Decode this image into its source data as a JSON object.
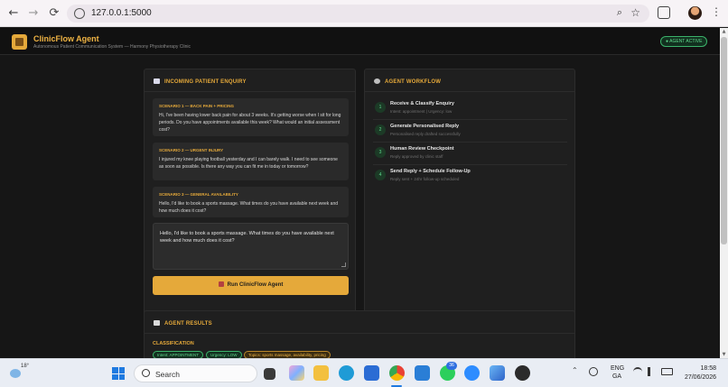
{
  "browser": {
    "url": "127.0.0.1:5000",
    "back": "←",
    "forward": "→",
    "reload": "⟳",
    "zoom_icon": "zoom-icon",
    "star": "☆",
    "kebab": "⋮"
  },
  "app": {
    "title": "ClinicFlow Agent",
    "subtitle": "Autonomous Patient Communication System — Harmony Physiotherapy Clinic",
    "status": "● AGENT ACTIVE"
  },
  "enquiry": {
    "heading": "INCOMING PATIENT ENQUIRY",
    "scenarios": [
      {
        "title": "SCENARIO 1 — BACK PAIN + PRICING",
        "text": "Hi, I've been having lower back pain for about 3 weeks. It's getting worse when I sit for long periods. Do you have appointments available this week? What would an initial assessment cost?"
      },
      {
        "title": "SCENARIO 2 — URGENT INJURY",
        "text": "I injured my knee playing football yesterday and I can barely walk. I need to see someone as soon as possible. Is there any way you can fit me in today or tomorrow?"
      },
      {
        "title": "SCENARIO 3 — GENERAL AVAILABILITY",
        "text": "Hello, I'd like to book a sports massage. What times do you have available next week and how much does it cost?"
      }
    ],
    "input_value": "Hello, I'd like to book a sports massage. What times do you have available next week and how much does it cost?",
    "run_button": "Run ClinicFlow Agent"
  },
  "workflow": {
    "heading": "AGENT WORKFLOW",
    "steps": [
      {
        "num": "1",
        "title": "Receive & Classify Enquiry",
        "sub": "Intent: appointment | Urgency: low"
      },
      {
        "num": "2",
        "title": "Generate Personalised Reply",
        "sub": "Personalised reply drafted successfully"
      },
      {
        "num": "3",
        "title": "Human Review Checkpoint",
        "sub": "Reply approved by clinic staff"
      },
      {
        "num": "4",
        "title": "Send Reply + Schedule Follow-Up",
        "sub": "Reply sent + 24hr follow-up scheduled"
      }
    ]
  },
  "results": {
    "heading": "AGENT RESULTS",
    "classification_label": "CLASSIFICATION",
    "tags": {
      "intent": "Intent: APPOINTMENT",
      "urgency": "Urgency: LOW",
      "topics": "Topics: sports massage, availability, pricing"
    }
  },
  "taskbar": {
    "temperature": "18°",
    "search_placeholder": "Search",
    "badge_count": "36",
    "language_1": "ENG",
    "language_2": "GA",
    "time": "18:58",
    "date": "27/06/2026"
  },
  "colors": {
    "accent": "#e5a93a",
    "status_green": "#5fd88d",
    "background": "#161616",
    "panel": "#1f1f1f"
  }
}
